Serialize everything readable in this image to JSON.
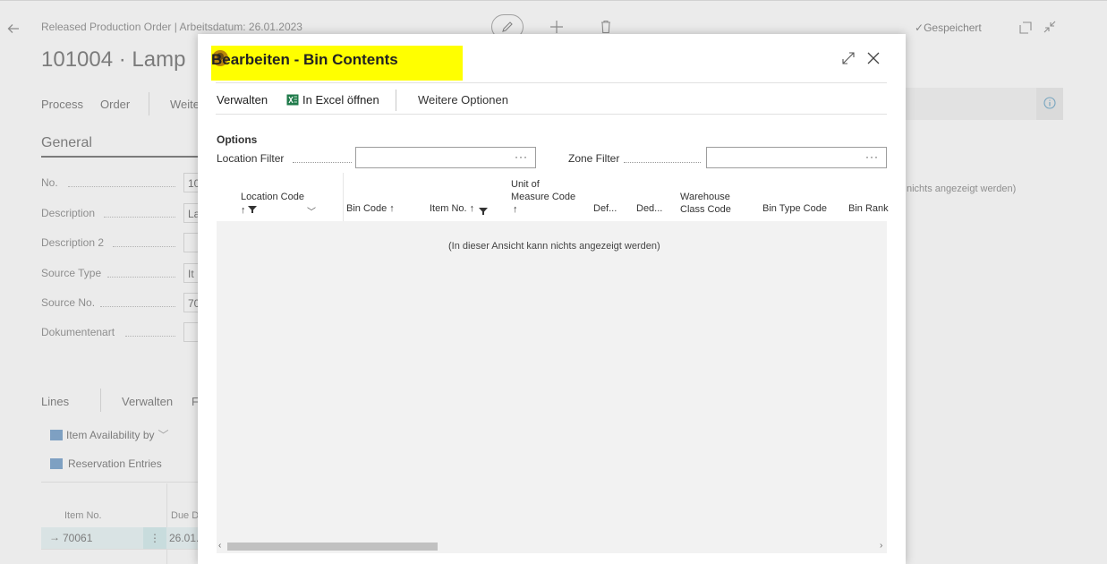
{
  "colors": {
    "accent": "#008489",
    "highlight": "#ffff00",
    "grid_bg": "#f2f2f2"
  },
  "header": {
    "breadcrumb": "Released Production Order | Arbeitsdatum: 26.01.2023",
    "title": "101004 · Lamp",
    "saved_label": "Gespeichert"
  },
  "action_bar": {
    "items": [
      "Process",
      "Order",
      "Weite"
    ]
  },
  "general": {
    "title": "General",
    "fields": [
      {
        "label": "No.",
        "value": "10"
      },
      {
        "label": "Description",
        "value": "La"
      },
      {
        "label": "Description 2",
        "value": ""
      },
      {
        "label": "Source Type",
        "value": "It"
      },
      {
        "label": "Source No.",
        "value": "70"
      },
      {
        "label": "Dokumentenart",
        "value": ""
      }
    ],
    "right_empty_message": "nichts angezeigt werden)"
  },
  "lines": {
    "title": "Lines",
    "manage_label": "Verwalten",
    "extra_label": "F",
    "item_availability": "Item Availability by",
    "reservation_entries": "Reservation Entries",
    "col_item_no": "Item No.",
    "col_due": "Due D",
    "row_item_no": "70061",
    "row_due": "26.01."
  },
  "dialog": {
    "title": "Bearbeiten - Bin Contents",
    "toolbar": {
      "manage": "Verwalten",
      "excel": "In Excel öffnen",
      "more": "Weitere Optionen"
    },
    "options_title": "Options",
    "location_filter_label": "Location Filter",
    "zone_filter_label": "Zone Filter",
    "filter_more": "···",
    "columns": {
      "location_code": "Location Code",
      "bin_code": "Bin Code ↑",
      "item_no": "Item No. ↑",
      "uom_line1": "Unit of",
      "uom_line2": "Measure Code",
      "default": "Def...",
      "dedicated": "Ded...",
      "warehouse_line1": "Warehouse",
      "warehouse_line2": "Class Code",
      "bin_type_code": "Bin Type Code",
      "bin_rank": "Bin Rank"
    },
    "empty_message": "(In dieser Ansicht kann nichts angezeigt werden)"
  }
}
